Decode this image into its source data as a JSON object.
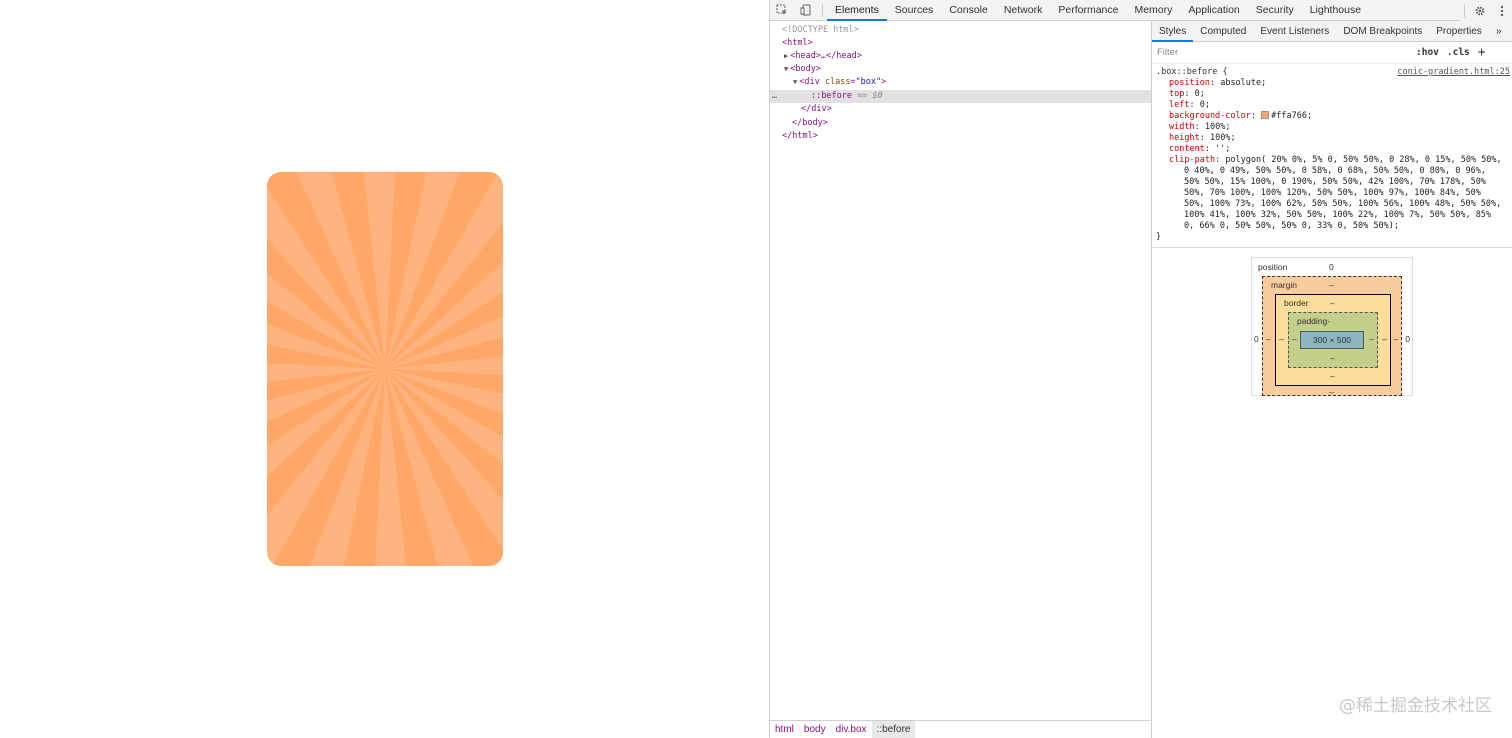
{
  "viewport": {
    "box_color": "#ffa766",
    "box_light_color": "#ffb47f"
  },
  "toolbar": {
    "inspect_icon": "inspect-element-icon",
    "device_icon": "device-toggle-icon",
    "tabs": [
      "Elements",
      "Sources",
      "Console",
      "Network",
      "Performance",
      "Memory",
      "Application",
      "Security",
      "Lighthouse"
    ],
    "active_tab": "Elements",
    "settings_icon": "gear-icon",
    "more_icon": "vertical-dots-icon"
  },
  "dom": {
    "doctype": "<!DOCTYPE html>",
    "html_open": "<html>",
    "head": "<head>…</head>",
    "body_open": "<body>",
    "div_open_tag": "<div",
    "div_attr_name": "class",
    "div_attr_value": "\"box\"",
    "div_open_end": ">",
    "before": "::before",
    "before_eq": "== $0",
    "div_close": "</div>",
    "body_close": "</body>",
    "html_close": "</html>",
    "dots": "…"
  },
  "breadcrumbs": [
    "html",
    "body",
    "div.box",
    "::before"
  ],
  "side": {
    "tabs": [
      "Styles",
      "Computed",
      "Event Listeners",
      "DOM Breakpoints",
      "Properties"
    ],
    "active_tab": "Styles",
    "more": "»",
    "filter_placeholder": "Filter",
    "hov": ":hov",
    "cls": ".cls",
    "plus": "+"
  },
  "rule": {
    "selector": ".box::before {",
    "source": "conic-gradient.html:25",
    "close": "}",
    "declarations": [
      {
        "name": "position",
        "value": "absolute;"
      },
      {
        "name": "top",
        "value": "0;"
      },
      {
        "name": "left",
        "value": "0;"
      },
      {
        "name": "background-color",
        "value": "#ffa766;"
      },
      {
        "name": "width",
        "value": "100%;"
      },
      {
        "name": "height",
        "value": "100%;"
      },
      {
        "name": "content",
        "value": "'';"
      },
      {
        "name": "clip-path",
        "value": "polygon( 20% 0%, 5% 0, 50% 50%, 0 28%, 0 15%, 50% 50%,"
      }
    ],
    "clip_path_continuation": [
      "0 40%, 0 49%, 50% 50%, 0 58%, 0 68%, 50% 50%, 0 80%, 0 96%,",
      "50% 50%, 15% 100%, 0 190%, 50% 50%, 42% 100%, 70% 178%, 50%",
      "50%, 70% 100%, 100% 120%, 50% 50%, 100% 97%, 100% 84%, 50%",
      "50%, 100% 73%, 100% 62%, 50% 50%, 100% 56%, 100% 48%, 50% 50%,",
      "100% 41%, 100% 32%, 50% 50%, 100% 22%, 100% 7%, 50% 50%, 85%",
      "0, 66% 0, 50% 50%, 50% 0, 33% 0, 50% 50%);"
    ]
  },
  "box_model": {
    "position_label": "position",
    "position_value": "0",
    "margin_label": "margin",
    "border_label": "border",
    "padding_label": "padding-",
    "content_size": "300 × 500",
    "dash": "–",
    "left_value": "0",
    "right_value": "0"
  },
  "watermark": "@稀土掘金技术社区"
}
